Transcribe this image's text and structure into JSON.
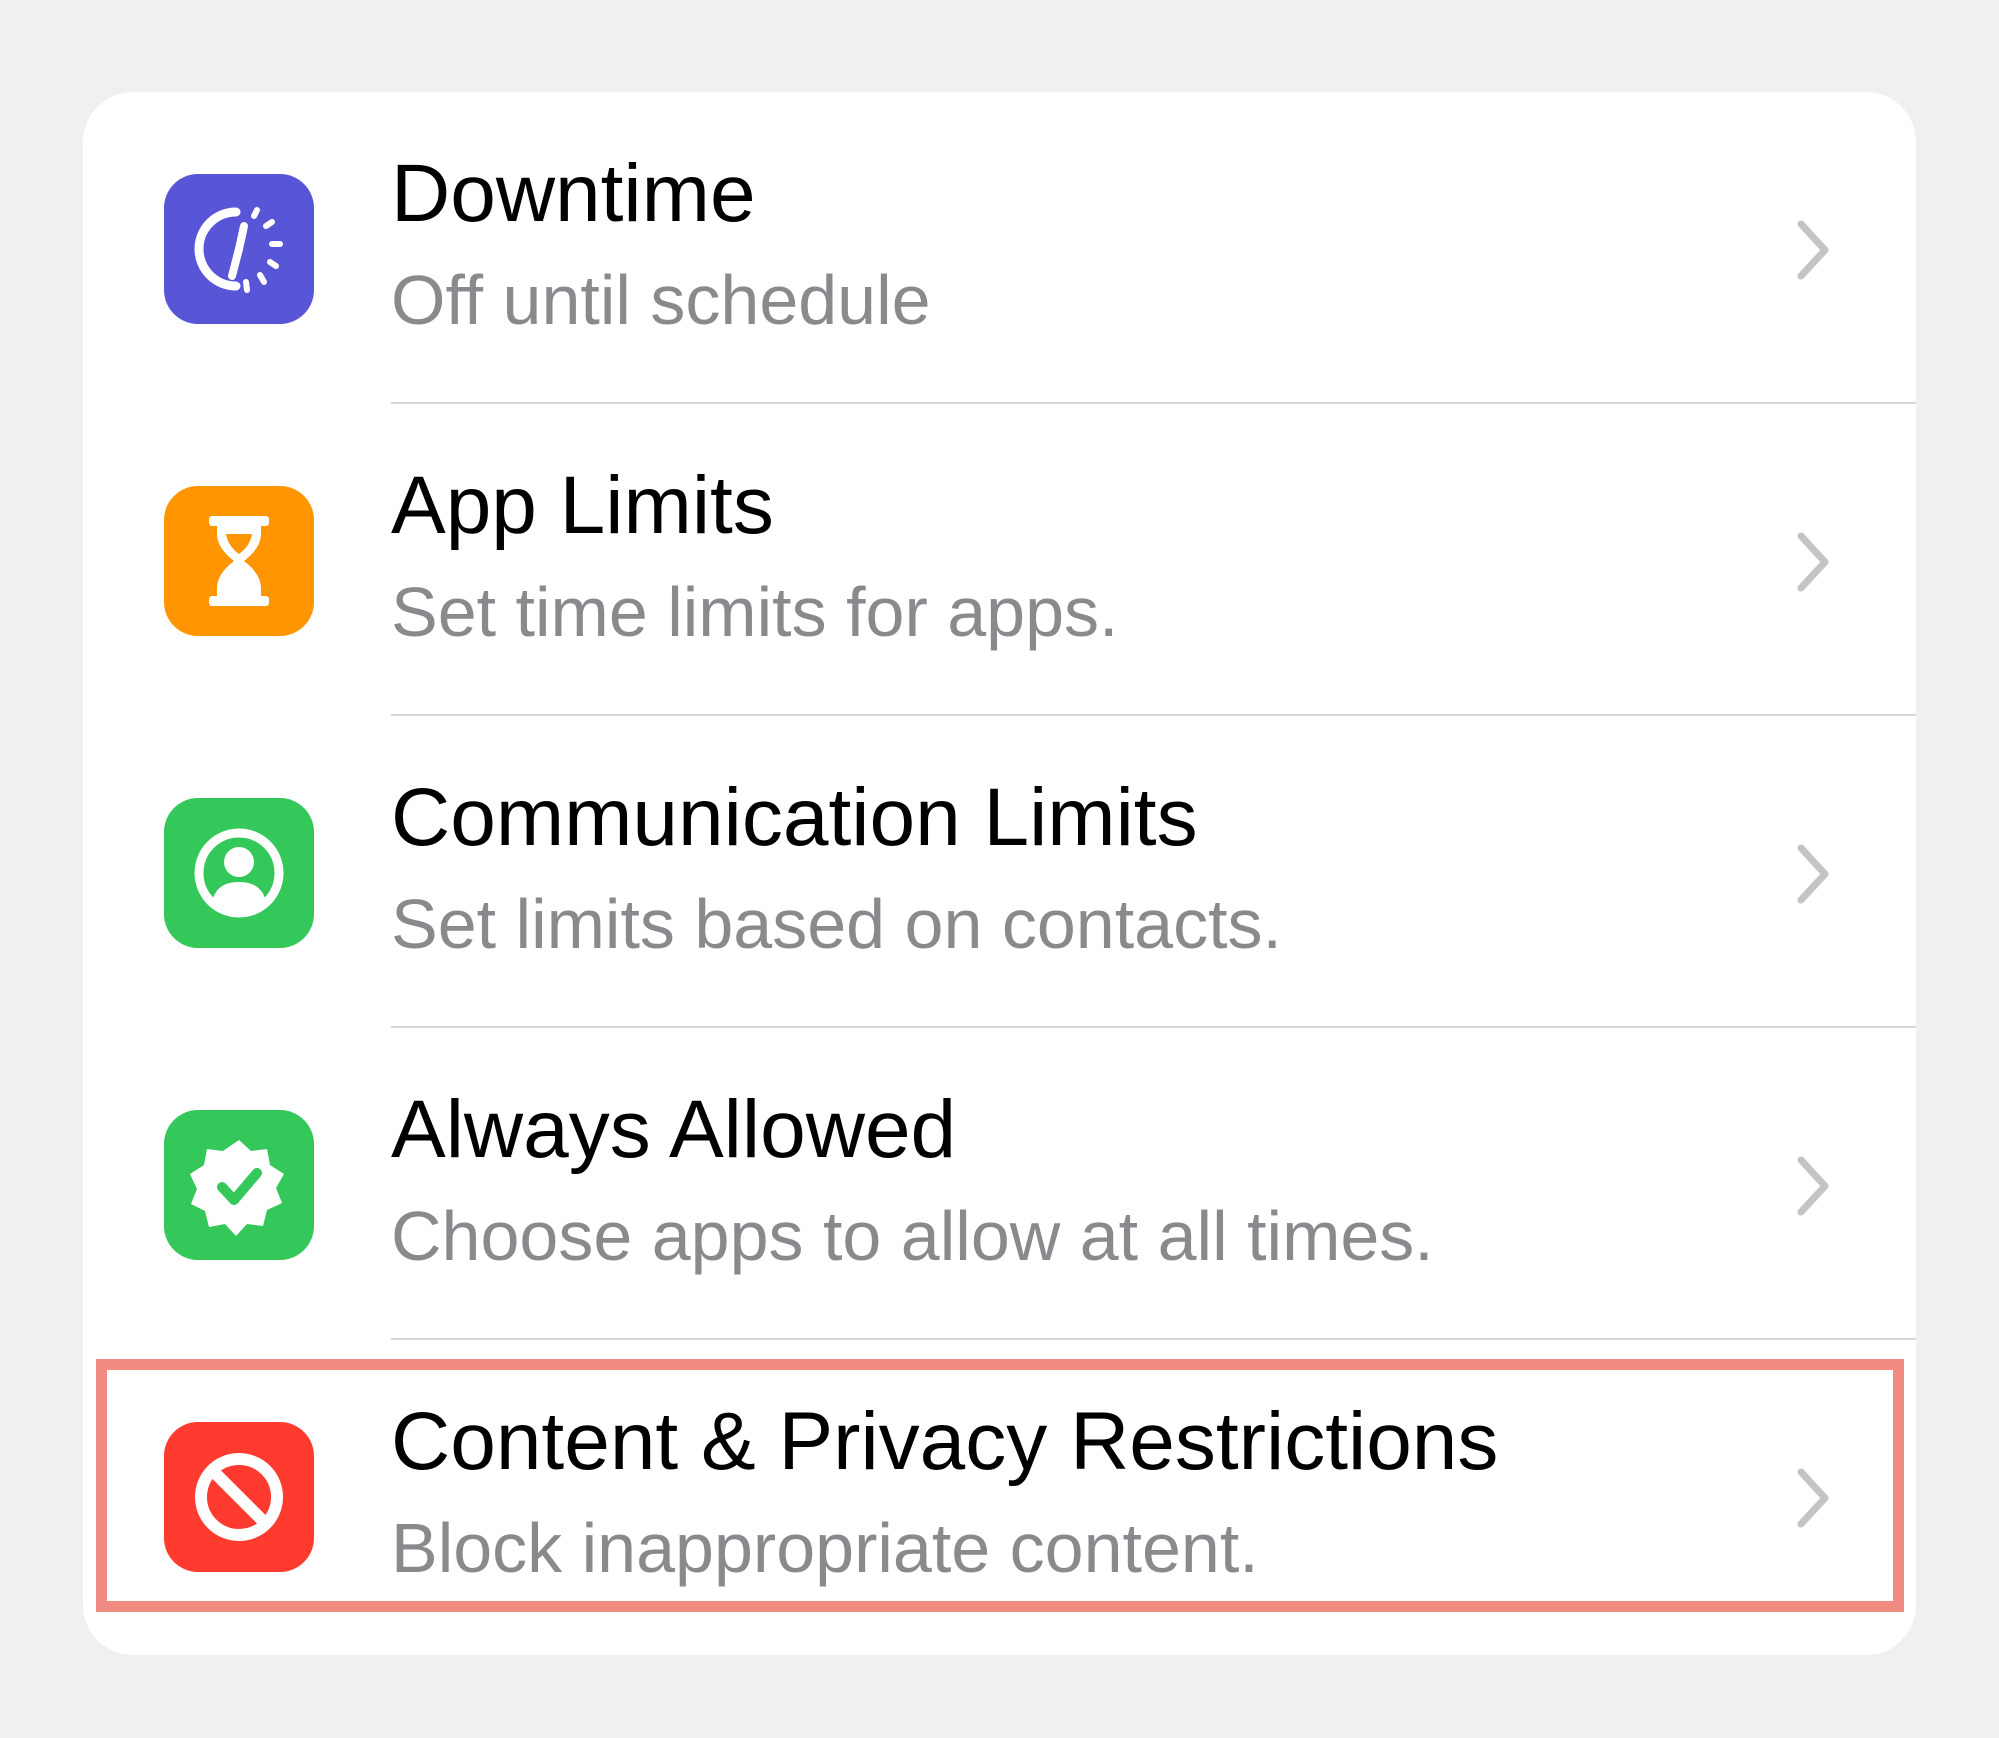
{
  "settings": {
    "items": [
      {
        "title": "Downtime",
        "subtitle": "Off until schedule",
        "icon": "downtime-icon",
        "icon_color": "#5856d6"
      },
      {
        "title": "App Limits",
        "subtitle": "Set time limits for apps.",
        "icon": "hourglass-icon",
        "icon_color": "#ff9500"
      },
      {
        "title": "Communication Limits",
        "subtitle": "Set limits based on contacts.",
        "icon": "person-circle-icon",
        "icon_color": "#34c759"
      },
      {
        "title": "Always Allowed",
        "subtitle": "Choose apps to allow at all times.",
        "icon": "checkmark-seal-icon",
        "icon_color": "#34c759"
      },
      {
        "title": "Content & Privacy Restrictions",
        "subtitle": "Block inappropriate content.",
        "icon": "no-entry-icon",
        "icon_color": "#ff3b30"
      }
    ],
    "chevron_icon": "chevron-right-icon",
    "highlight_color": "#f28b82"
  }
}
